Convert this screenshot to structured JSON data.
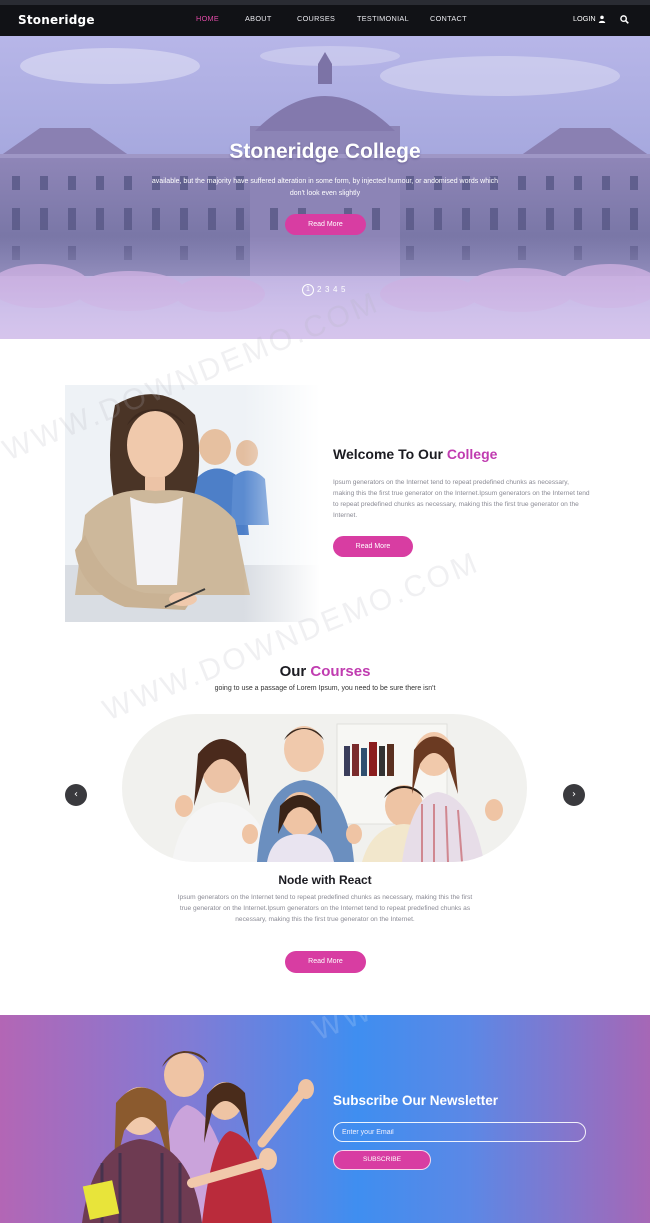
{
  "colors": {
    "accent": "#d83da2",
    "nav_bg": "#111216",
    "accent_text": "#c03cb0"
  },
  "nav": {
    "brand": "Stoneridge",
    "items": [
      "HOME",
      "ABOUT",
      "COURSES",
      "TESTIMONIAL",
      "CONTACT"
    ],
    "active": "HOME",
    "login": "LOGIN",
    "icons": [
      "user-icon",
      "search-icon"
    ]
  },
  "hero": {
    "title": "Stoneridge College",
    "subtitle": "available, but the majority have suffered alteration in some form, by injected humour, or andomised words which don't look even slightly",
    "button": "Read More",
    "pages": [
      "1",
      "2",
      "3",
      "4",
      "5"
    ],
    "current_page": "1"
  },
  "welcome": {
    "title_prefix": "Welcome To Our",
    "title_accent": "College",
    "text": "Ipsum generators on the Internet tend to repeat predefined chunks as necessary, making this the first true generator on the Internet.Ipsum generators on the Internet tend to repeat predefined chunks as necessary, making this the first true generator on the Internet.",
    "button": "Read More"
  },
  "courses": {
    "title_prefix": "Our",
    "title_accent": "Courses",
    "subtitle": "going to use a passage of Lorem Ipsum, you need to be sure there isn't",
    "course_name": "Node with React",
    "course_desc": "Ipsum generators on the Internet tend to repeat predefined chunks as necessary, making this the first true generator on the Internet.Ipsum generators on the Internet tend to repeat predefined chunks as necessary, making this the first true generator on the Internet.",
    "button": "Read More",
    "prev_icon": "‹",
    "next_icon": "›"
  },
  "newsletter": {
    "title": "Subscribe Our Newsletter",
    "placeholder": "Enter your Email",
    "button": "SUBSCRIBE"
  },
  "watermark": "WWW.DOWNDEMO.COM"
}
